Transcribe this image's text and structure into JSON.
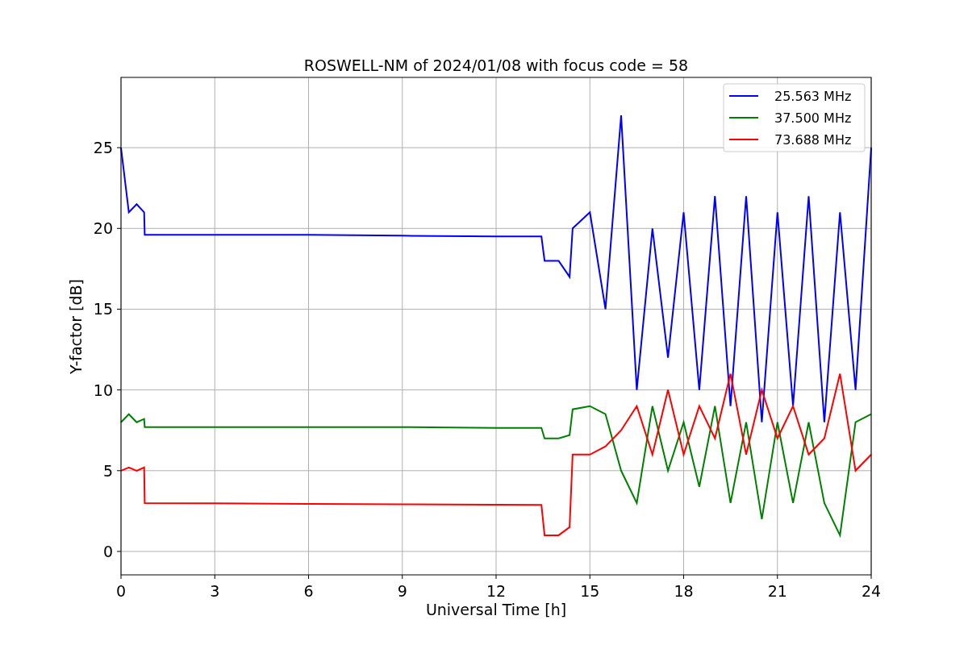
{
  "chart_data": {
    "type": "line",
    "title": "ROSWELL-NM of 2024/01/08 with focus code = 58",
    "xlabel": "Universal Time [h]",
    "ylabel": "Y-factor [dB]",
    "x": [
      0,
      0.25,
      0.5,
      0.74,
      0.76,
      3,
      6,
      9,
      12,
      13.45,
      13.55,
      14,
      14.35,
      14.45,
      15,
      15.5,
      16,
      16.5,
      17,
      17.5,
      18,
      18.5,
      19,
      19.5,
      20,
      20.5,
      21,
      21.5,
      22,
      22.5,
      23,
      23.5,
      24
    ],
    "series": [
      {
        "name": "25.563 MHz",
        "color": "#0000ff",
        "values": [
          25,
          21,
          21.5,
          21,
          19.6,
          19.6,
          19.6,
          19.55,
          19.5,
          19.5,
          18,
          18,
          17,
          20,
          21,
          15,
          27,
          10,
          20,
          12,
          21,
          10,
          22,
          9,
          22,
          8,
          21,
          9,
          22,
          8,
          21,
          10,
          25
        ]
      },
      {
        "name": "37.500 MHz",
        "color": "#008000",
        "values": [
          8,
          8.5,
          8,
          8.2,
          7.7,
          7.7,
          7.7,
          7.7,
          7.65,
          7.65,
          7,
          7,
          7.2,
          8.8,
          9,
          8.5,
          5,
          3,
          9,
          5,
          8,
          4,
          9,
          3,
          8,
          2,
          8,
          3,
          8,
          3,
          1,
          8,
          8.5
        ]
      },
      {
        "name": "73.688 MHz",
        "color": "#ff0000",
        "values": [
          5,
          5.2,
          5,
          5.2,
          3,
          2.98,
          2.95,
          2.92,
          2.9,
          2.88,
          1,
          1,
          1.5,
          6,
          6,
          6.5,
          7.5,
          9,
          6,
          10,
          6,
          9,
          7,
          11,
          6,
          10,
          7,
          9,
          6,
          7,
          11,
          5,
          6
        ]
      }
    ],
    "grid": true,
    "legend": "upper right",
    "xlim": [
      0,
      24
    ],
    "ylim": [
      -1.45,
      29.35
    ],
    "xticks": [
      0,
      3,
      6,
      9,
      12,
      15,
      18,
      21,
      24
    ],
    "yticks": [
      0,
      5,
      10,
      15,
      20,
      25
    ]
  }
}
